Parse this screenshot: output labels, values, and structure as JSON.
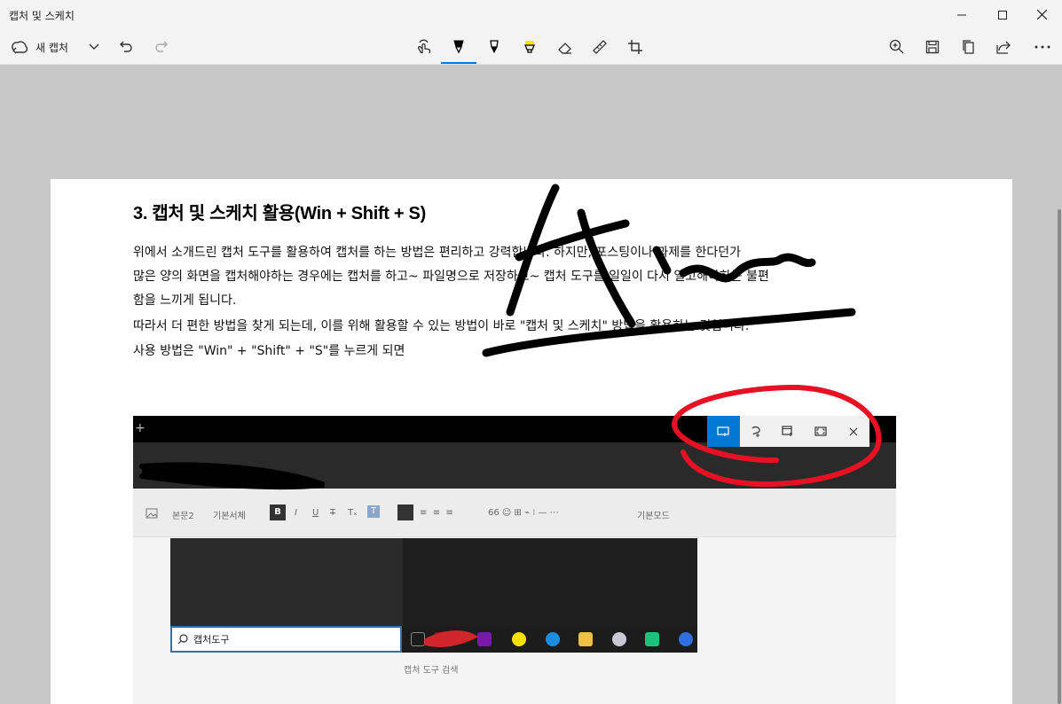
{
  "app": {
    "title": "캡처 및 스케치",
    "new_capture_label": "새 캡처"
  },
  "window_controls": [
    "minimize",
    "maximize",
    "close"
  ],
  "toolbar": {
    "left": [
      "new-capture",
      "dropdown-chevron",
      "undo",
      "redo"
    ],
    "center_tools": [
      "touch-writing",
      "ballpoint-pen",
      "pencil",
      "highlighter",
      "eraser",
      "ruler",
      "crop"
    ],
    "selected_tool": "ballpoint-pen",
    "right": [
      "zoom",
      "save",
      "copy",
      "share",
      "more"
    ]
  },
  "document": {
    "heading": "3. 캡처 및 스케치 활용(Win + Shift + S)",
    "paragraph_lines": [
      "  위에서 소개드린 캡처 도구를 활용하여 캡처를 하는 방법은 편리하고 강력합니다. 하지만, 포스팅이나 과제를 한다던가",
      "많은 양의 화면을 캡처해야하는 경우에는 캡처를 하고~ 파일명으로 저장하고~ 캡처 도구를 일일이 다시 열고해야하는 불편",
      "함을 느끼게 됩니다.",
      "  따라서 더 편한 방법을 찾게 되는데, 이를 위해 활용할 수 있는 방법이 바로 \"캡처 및 스케치\" 방법을 활용하는 것입니다.",
      "사용 방법은 \"Win\" + \"Shift\" + \"S\"를 누르게 되면"
    ]
  },
  "embedded_screenshot": {
    "snip_modes": [
      "rectangular-snip",
      "freeform-snip",
      "window-snip",
      "fullscreen-snip",
      "close"
    ],
    "editor_toolbar": {
      "image_label": "",
      "style_label": "본문2",
      "font_label": "기본서체",
      "format_buttons": [
        "B",
        "I",
        "U",
        "T",
        "Tₓ",
        "T"
      ],
      "mode_label": "기본모드"
    },
    "search_value": "캡처도구",
    "caption": "캡처 도구 검색"
  },
  "colors": {
    "accent": "#0078d4",
    "ink_black": "#000000",
    "ink_red": "#e81123",
    "canvas_bg": "#c8c8c8"
  }
}
